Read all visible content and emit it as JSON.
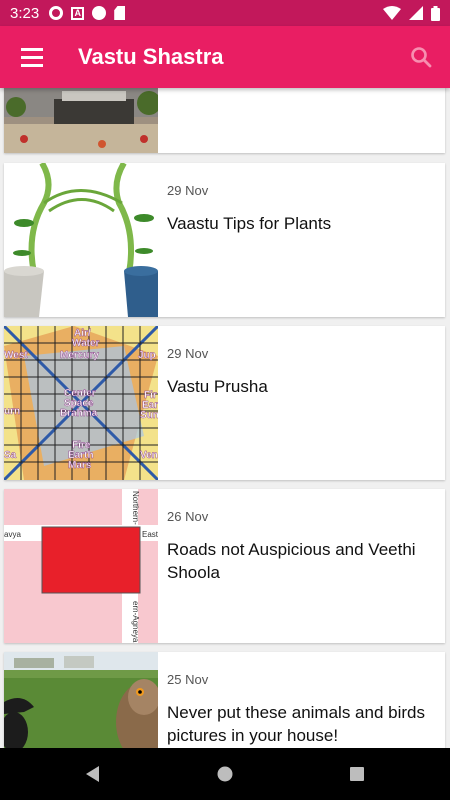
{
  "status_bar": {
    "time": "3:23",
    "icons": [
      "gear-icon",
      "a-icon",
      "circle-icon",
      "sd-card-icon"
    ],
    "right_icons": [
      "wifi-icon",
      "signal-icon",
      "battery-icon"
    ]
  },
  "app_bar": {
    "title": "Vastu Shastra",
    "menu_icon": "menu-icon",
    "search_icon": "search-icon"
  },
  "colors": {
    "primary": "#e91e63",
    "status": "#c2185b"
  },
  "articles": [
    {
      "date": "",
      "title": ""
    },
    {
      "date": "29 Nov",
      "title": "Vaastu Tips for Plants"
    },
    {
      "date": "29 Nov",
      "title": "Vastu Prusha"
    },
    {
      "date": "26 Nov",
      "title": "Roads not Auspicious and  Veethi Shoola"
    },
    {
      "date": "25 Nov",
      "title": "Never put these animals and birds pictures in your house!"
    }
  ],
  "thumb_text": {
    "prusha": [
      "Air/",
      "Water",
      "Mercury",
      "West",
      "Jup",
      "Center",
      "Space",
      "Brahma",
      "Fire",
      "Earth",
      "Mars",
      "urn",
      "Fir",
      "Eart",
      "Sun",
      "Ven",
      "Sa"
    ],
    "roads": [
      "Northern-",
      "avya",
      "East",
      "ern-Agneya"
    ]
  },
  "nav": {
    "back": "back-icon",
    "home": "home-icon",
    "recents": "recents-icon"
  }
}
